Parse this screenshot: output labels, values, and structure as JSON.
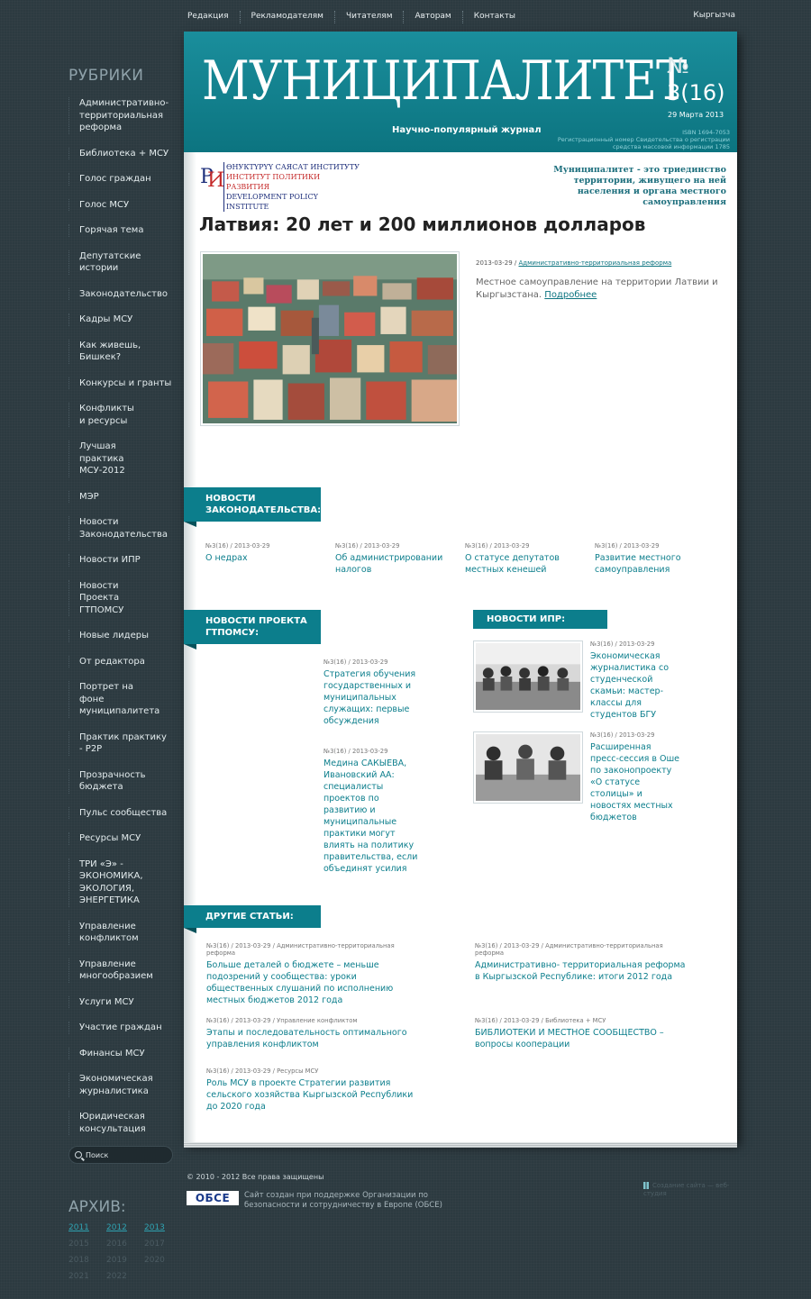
{
  "topnav": {
    "items": [
      "Редакция",
      "Рекламодателям",
      "Читателям",
      "Авторам",
      "Контакты"
    ],
    "language": "Кыргызча"
  },
  "sidebar": {
    "title": "РУБРИКИ",
    "rubrics": [
      "Административно-территориальная реформа",
      "Библиотека + МСУ",
      "Голос граждан",
      "Голос МСУ",
      "Горячая тема",
      "Депутатские истории",
      "Законодательство",
      "Кадры МСУ",
      "Как живешь, Бишкек?",
      "Конкурсы и гранты",
      "Конфликты и ресурсы",
      "Лучшая практика МСУ-2012",
      "МЭР",
      "Новости Законодательства",
      "Новости ИПР",
      "Новости Проекта ГТПОМСУ",
      "Новые лидеры",
      "От редактора",
      "Портрет на фоне муниципалитета",
      "Практик практику - P2P",
      "Прозрачность бюджета",
      "Пульс сообщества",
      "Ресурсы МСУ",
      "ТРИ «Э» - ЭКОНОМИКА, ЭКОЛОГИЯ, ЭНЕРГЕТИКА",
      "Управление конфликтом",
      "Управление многообразием",
      "Услуги МСУ",
      "Участие граждан",
      "Финансы МСУ",
      "Экономическая журналистика",
      "Юридическая консультация"
    ],
    "search_placeholder": "Поиск",
    "archive_title": "АРХИВ:",
    "archive_years": [
      "2011",
      "2012",
      "2013",
      "2015",
      "2016",
      "2017",
      "2018",
      "2019",
      "2020",
      "2021",
      "2022"
    ]
  },
  "header": {
    "masthead": "МУНИЦИПАЛИТЕТ",
    "tagline": "Научно-популярный журнал",
    "issue_symbol": "№",
    "issue_number": "3(16)",
    "issue_date": "29 Марта 2013",
    "isbn": "ISBN 1694-7053",
    "registration": "Регистрационный номер Свидетельства о регистрации средства массовой информации 1785",
    "logo_lines": [
      "ӨНУКТҮРҮҮ САЯСАТ ИНСТИТУТУ",
      "ИНСТИТУТ ПОЛИТИКИ РАЗВИТИЯ",
      "DEVELOPMENT POLICY INSTITUTE"
    ],
    "motto": "Муниципалитет - это триединство территории, живущего на ней населения и органа местного самоуправления"
  },
  "featured": {
    "title": "Латвия: 20 лет и 200 миллионов долларов",
    "date": "2013-03-29",
    "category": "Административно-территориальная реформа",
    "summary": "Местное самоуправление на территории Латвии и Кыргызстана.",
    "more": "Подробнее"
  },
  "sections": {
    "law_news": {
      "title": "НОВОСТИ ЗАКОНОДАТЕЛЬСТВА:",
      "items": [
        {
          "meta": "№3(16) / 2013-03-29",
          "title": "О недрах"
        },
        {
          "meta": "№3(16) / 2013-03-29",
          "title": "Об администрировании налогов"
        },
        {
          "meta": "№3(16) / 2013-03-29",
          "title": "О статусе депутатов местных кенешей"
        },
        {
          "meta": "№3(16) / 2013-03-29",
          "title": "Развитие местного самоуправления"
        }
      ]
    },
    "project_news": {
      "title": "НОВОСТИ ПРОЕКТА ГТПОМСУ:",
      "items": [
        {
          "meta": "№3(16) / 2013-03-29",
          "title": "Стратегия обучения государственных и муниципальных служащих: первые обсуждения"
        },
        {
          "meta": "№3(16) / 2013-03-29",
          "title": "Медина САКЫЕВА, Ивановский АА: специалисты проектов по развитию и муниципальные практики могут влиять на политику правительства, если объединят усилия"
        }
      ]
    },
    "ipr_news": {
      "title": "НОВОСТИ ИПР:",
      "items": [
        {
          "meta": "№3(16) / 2013-03-29",
          "title": "Экономическая журналистика со студенческой скамьи: мастер-классы для студентов БГУ"
        },
        {
          "meta": "№3(16) / 2013-03-29",
          "title": "Расширенная пресс-сессия в Оше по законопроекту «О статусе столицы» и новостях местных бюджетов"
        }
      ]
    },
    "other": {
      "title": "ДРУГИЕ СТАТЬИ:",
      "items": [
        {
          "meta": "№3(16) / 2013-03-29 / Административно-территориальная реформа",
          "title": "Больше деталей о бюджете – меньше подозрений у сообщества: уроки общественных слушаний по исполнению местных бюджетов 2012 года"
        },
        {
          "meta": "№3(16) / 2013-03-29 / Административно-территориальная реформа",
          "title": "Административно- территориальная реформа в Кыргызской Республике: итоги 2012 года"
        },
        {
          "meta": "№3(16) / 2013-03-29 / Управление конфликтом",
          "title": "Этапы и последовательность оптимального управления конфликтом"
        },
        {
          "meta": "№3(16) / 2013-03-29 / Библиотека + МСУ",
          "title": "БИБЛИОТЕКИ И МЕСТНОЕ СООБЩЕСТВО – вопросы кооперации"
        },
        {
          "meta": "№3(16) / 2013-03-29 / Ресурсы МСУ",
          "title": "Роль МСУ в проекте Стратегии развития сельского хозяйства Кыргызской Республики до 2020 года"
        }
      ]
    }
  },
  "footer": {
    "copyright": "© 2010 - 2012 Все права защищены",
    "osce_logo": "ОБСЕ",
    "osce_text": "Сайт создан при поддержке Организации по безопасности и сотрудничеству в Европе (ОБСЕ)",
    "right_text": "Создание сайта — веб-студия"
  },
  "colors": {
    "accent": "#0c7e8c",
    "background": "#2c3a40",
    "link": "#0c7e8c"
  }
}
